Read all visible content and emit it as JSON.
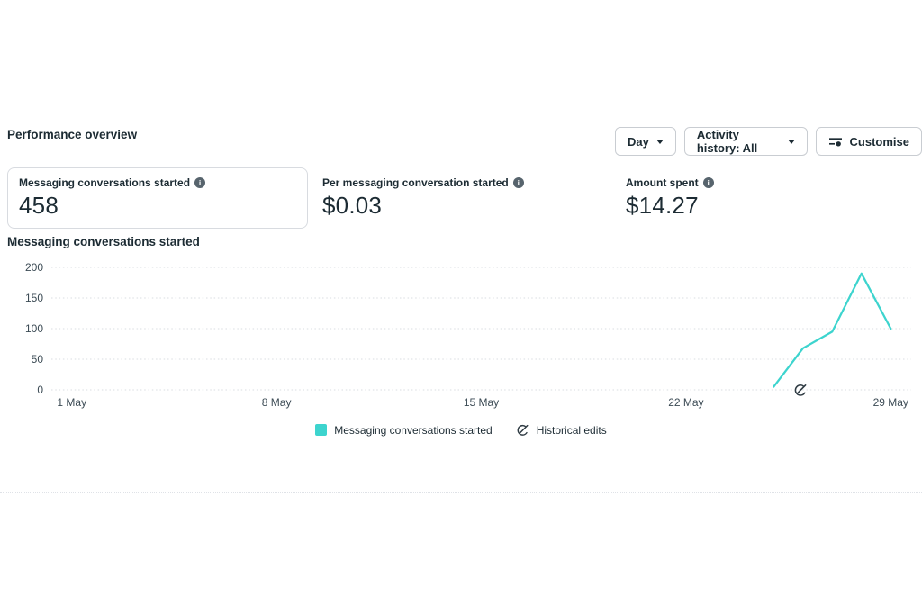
{
  "header": {
    "title": "Performance overview"
  },
  "toolbar": {
    "day_label": "Day",
    "activity_label": "Activity history: All",
    "customise_label": "Customise",
    "day_icon": "chevron-down-icon",
    "activity_icon": "chevron-down-icon",
    "customise_icon": "filter-sliders-icon"
  },
  "metrics": [
    {
      "label": "Messaging conversations started",
      "value": "458",
      "info_icon": "info-icon",
      "selected": true
    },
    {
      "label": "Per messaging conversation started",
      "value": "$0.03",
      "info_icon": "info-icon",
      "selected": false
    },
    {
      "label": "Amount spent",
      "value": "$14.27",
      "info_icon": "info-icon",
      "selected": false
    }
  ],
  "colors": {
    "accent_teal": "#3dd4ce",
    "text_dark": "#1c2b33",
    "axis_text": "#3b4a54",
    "gridline": "#d9dde1",
    "border": "#c9cdd2"
  },
  "chart_data": {
    "type": "line",
    "title": "Messaging conversations started",
    "xlabel": "",
    "ylabel": "",
    "ylim": [
      0,
      200
    ],
    "y_ticks": [
      0,
      50,
      100,
      150,
      200
    ],
    "x_ticks": [
      {
        "day": 1,
        "label": "1 May"
      },
      {
        "day": 8,
        "label": "8 May"
      },
      {
        "day": 15,
        "label": "15 May"
      },
      {
        "day": 22,
        "label": "22 May"
      },
      {
        "day": 29,
        "label": "29 May"
      }
    ],
    "x_domain": [
      0.3,
      29.7
    ],
    "grid": "horizontal-dotted",
    "line_color": "#3dd4ce",
    "series": [
      {
        "name": "Messaging conversations started",
        "points": [
          {
            "day": 25,
            "value": 5
          },
          {
            "day": 26,
            "value": 68
          },
          {
            "day": 27,
            "value": 95
          },
          {
            "day": 28,
            "value": 190
          },
          {
            "day": 29,
            "value": 100
          }
        ]
      }
    ],
    "historical_edits": {
      "marker_day": 25.9
    },
    "legend_position": "bottom-center",
    "legend": [
      {
        "label": "Messaging conversations started",
        "swatch_color": "#3dd4ce",
        "icon": "legend-swatch"
      },
      {
        "label": "Historical edits",
        "icon": "historical-edit-icon"
      }
    ]
  }
}
